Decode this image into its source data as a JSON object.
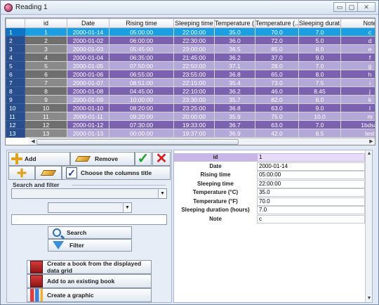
{
  "window": {
    "title": "Reading 1",
    "min": "▭",
    "max": "▢",
    "close": "✕"
  },
  "grid": {
    "columns": [
      "id",
      "Date",
      "Rising time",
      "Sleeping time",
      "Temperature (...",
      "Temperature (...",
      "Sleeping durat...",
      "Note"
    ],
    "rows": [
      {
        "n": "1",
        "id": "1",
        "date": "2000-01-14",
        "rise": "05:00:00",
        "sleep": "22:00:00",
        "tc": "35.0",
        "tf": "70.0",
        "dur": "7.0",
        "note": "c"
      },
      {
        "n": "2",
        "id": "2",
        "date": "2000-01-02",
        "rise": "06:00:00",
        "sleep": "22:30:00",
        "tc": "36.0",
        "tf": "72.0",
        "dur": "5.0",
        "note": "d"
      },
      {
        "n": "3",
        "id": "3",
        "date": "2000-01-03",
        "rise": "05:45:00",
        "sleep": "23:00:00",
        "tc": "36.5",
        "tf": "85.0",
        "dur": "8.0",
        "note": "e"
      },
      {
        "n": "4",
        "id": "4",
        "date": "2000-01-04",
        "rise": "06:35:00",
        "sleep": "21:45:00",
        "tc": "36.2",
        "tf": "37.0",
        "dur": "9.0",
        "note": "f"
      },
      {
        "n": "5",
        "id": "5",
        "date": "2000-01-05",
        "rise": "07:50:00",
        "sleep": "22:50:00",
        "tc": "37.1",
        "tf": "28.0",
        "dur": "7.0",
        "note": "g"
      },
      {
        "n": "6",
        "id": "6",
        "date": "2000-01-06",
        "rise": "06:55:00",
        "sleep": "23:55:00",
        "tc": "36.8",
        "tf": "65.0",
        "dur": "8.0",
        "note": "h"
      },
      {
        "n": "7",
        "id": "7",
        "date": "2000-01-07",
        "rise": "08:51:00",
        "sleep": "22:15:00",
        "tc": "35.4",
        "tf": "73.0",
        "dur": "7.5",
        "note": "i"
      },
      {
        "n": "8",
        "id": "8",
        "date": "2000-01-08",
        "rise": "04:45:00",
        "sleep": "22:10:00",
        "tc": "36.2",
        "tf": "46.0",
        "dur": "8.45",
        "note": "j"
      },
      {
        "n": "9",
        "id": "9",
        "date": "2000-01-09",
        "rise": "10:00:00",
        "sleep": "23:30:00",
        "tc": "35.7",
        "tf": "82.0",
        "dur": "8.0",
        "note": "k"
      },
      {
        "n": "10",
        "id": "10",
        "date": "2000-01-10",
        "rise": "08:20:00",
        "sleep": "23:25:00",
        "tc": "36.8",
        "tf": "63.0",
        "dur": "9.0",
        "note": "l"
      },
      {
        "n": "11",
        "id": "11",
        "date": "2000-01-11",
        "rise": "09:20:00",
        "sleep": "20:00:00",
        "tc": "35.9",
        "tf": "75.0",
        "dur": "10.0",
        "note": "m"
      },
      {
        "n": "12",
        "id": "12",
        "date": "2000-01-12",
        "rise": "07:30:00",
        "sleep": "19:33:00",
        "tc": "36.7",
        "tf": "63.0",
        "dur": "7.0",
        "note": "1bdsaf"
      },
      {
        "n": "13",
        "id": "13",
        "date": "2000-01-13",
        "rise": "00:00:00",
        "sleep": "19:37:00",
        "tc": "36.9",
        "tf": "42.0",
        "dur": "8.5",
        "note": "test"
      }
    ],
    "selected_row": 0
  },
  "left": {
    "add": "Add",
    "remove": "Remove",
    "choose_columns": "Choose the columns title",
    "search_filter_label": "Search and filter",
    "search": "Search",
    "filter": "Filter",
    "create_book": "Create a book from the displayed data grid",
    "add_existing": "Add to an existing book",
    "create_graphic": "Create a graphic"
  },
  "details": [
    {
      "key": "id",
      "value": "1"
    },
    {
      "key": "Date",
      "value": "2000-01-14"
    },
    {
      "key": "Rising time",
      "value": "05:00:00"
    },
    {
      "key": "Sleeping time",
      "value": "22:00:00"
    },
    {
      "key": "Temperature (°C)",
      "value": "35.0"
    },
    {
      "key": "Temperature (°F)",
      "value": "70.0"
    },
    {
      "key": "Sleeping duration (hours)",
      "value": "7.0"
    },
    {
      "key": "Note",
      "value": "c"
    }
  ],
  "colors": {
    "selected": "#1b9ee2",
    "row_light": "#b4a8d8",
    "row_dark": "#7b62b1",
    "row_header": "#294e8d"
  }
}
